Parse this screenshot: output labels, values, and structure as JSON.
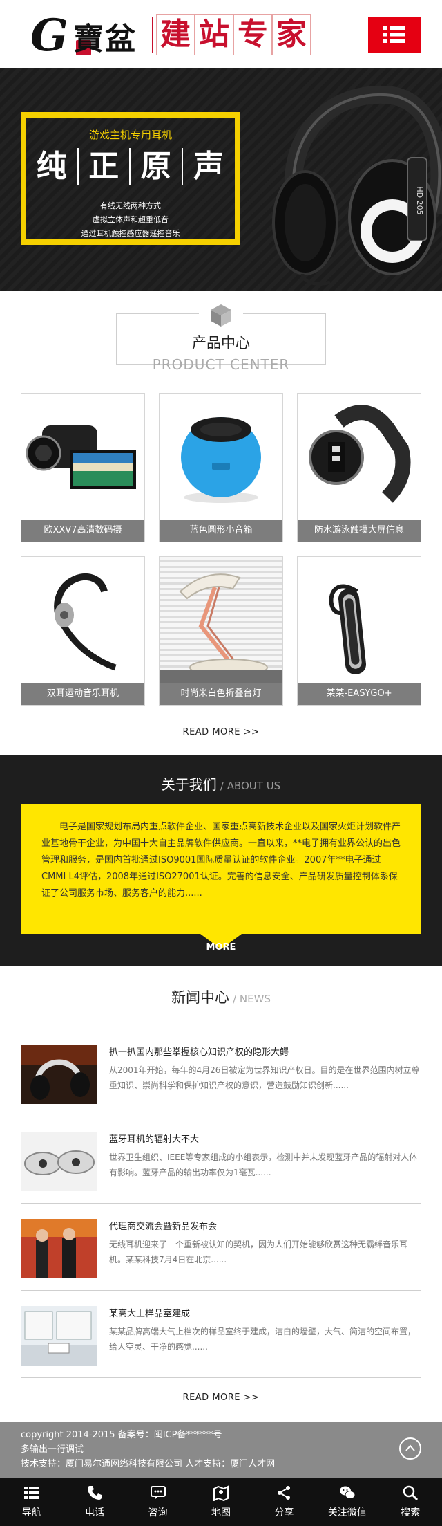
{
  "header": {
    "logo_g": "G",
    "logo_seal": "云",
    "logo_brand": "寶盆",
    "logo_slogan": [
      "建",
      "站",
      "专",
      "家"
    ],
    "menu_icon": "list-menu-icon"
  },
  "banner": {
    "subtitle": "游戏主机专用耳机",
    "big": [
      "纯",
      "正",
      "原",
      "声"
    ],
    "lines": [
      "有线无线两种方式",
      "虚拟立体声和超重低音",
      "通过耳机触控感应器遥控音乐"
    ],
    "headphone_label": "HD 205"
  },
  "products": {
    "title_cn": "产品中心",
    "title_en": "PRODUCT CENTER",
    "items": [
      {
        "caption": "欧XXV7高清数码摄"
      },
      {
        "caption": "蓝色圆形小音箱"
      },
      {
        "caption": "防水游泳触摸大屏信息"
      },
      {
        "caption": "双耳运动音乐耳机"
      },
      {
        "caption": "时尚米白色折叠台灯"
      },
      {
        "caption": "某某-EASYGO+"
      }
    ],
    "more": "READ MORE >>"
  },
  "about": {
    "title_cn": "关于我们",
    "title_en": "/ ABOUT US",
    "text": "电子是国家规划布局内重点软件企业、国家重点高新技术企业以及国家火炬计划软件产业基地骨干企业，为中国十大自主品牌软件供应商。一直以来，**电子拥有业界公认的出色管理和服务，是国内首批通过ISO9001国际质量认证的软件企业。2007年**电子通过CMMI  L4评估，2008年通过ISO27001认证。完善的信息安全、产品研发质量控制体系保证了公司服务市场、服务客户的能力......",
    "more": "MORE"
  },
  "news": {
    "title_cn": "新闻中心",
    "title_en": "/ NEWS",
    "items": [
      {
        "title": "扒一扒国内那些掌握核心知识产权的隐形大鳄",
        "desc": "从2001年开始，每年的4月26日被定为世界知识产权日。目的是在世界范围内树立尊重知识、崇尚科学和保护知识产权的意识，营造鼓励知识创新......"
      },
      {
        "title": "蓝牙耳机的辐射大不大",
        "desc": "世界卫生组织、IEEE等专家组成的小组表示，检测中并未发现蓝牙产品的辐射对人体有影响。蓝牙产品的输出功率仅为1毫瓦......"
      },
      {
        "title": "代理商交流会暨新品发布会",
        "desc": "无线耳机迎来了一个重新被认知的契机，因为人们开始能够欣赏这种无霸绊音乐耳机。某某科技7月4日在北京......"
      },
      {
        "title": "某高大上样品室建成",
        "desc": "某某品牌高端大气上档次的样品室终于建成，洁白的墙壁，大气、简洁的空间布置，给人空灵、干净的感觉......"
      }
    ],
    "more": "READ MORE >>"
  },
  "footer": {
    "line1": "copyright 2014-2015 备案号：闽ICP备******号",
    "line2": "多输出一行调试",
    "line3": "技术支持：厦门易尔通网络科技有限公司 人才支持：厦门人才网"
  },
  "bottom_nav": [
    {
      "label": "导航",
      "icon": "list-icon"
    },
    {
      "label": "电话",
      "icon": "phone-icon"
    },
    {
      "label": "咨询",
      "icon": "chat-icon"
    },
    {
      "label": "地图",
      "icon": "map-icon"
    },
    {
      "label": "分享",
      "icon": "share-icon"
    },
    {
      "label": "关注微信",
      "icon": "wechat-icon"
    },
    {
      "label": "搜索",
      "icon": "search-icon"
    }
  ],
  "colors": {
    "accent_red": "#e50012",
    "accent_yellow": "#ffe600",
    "dark": "#1e1e1e"
  }
}
